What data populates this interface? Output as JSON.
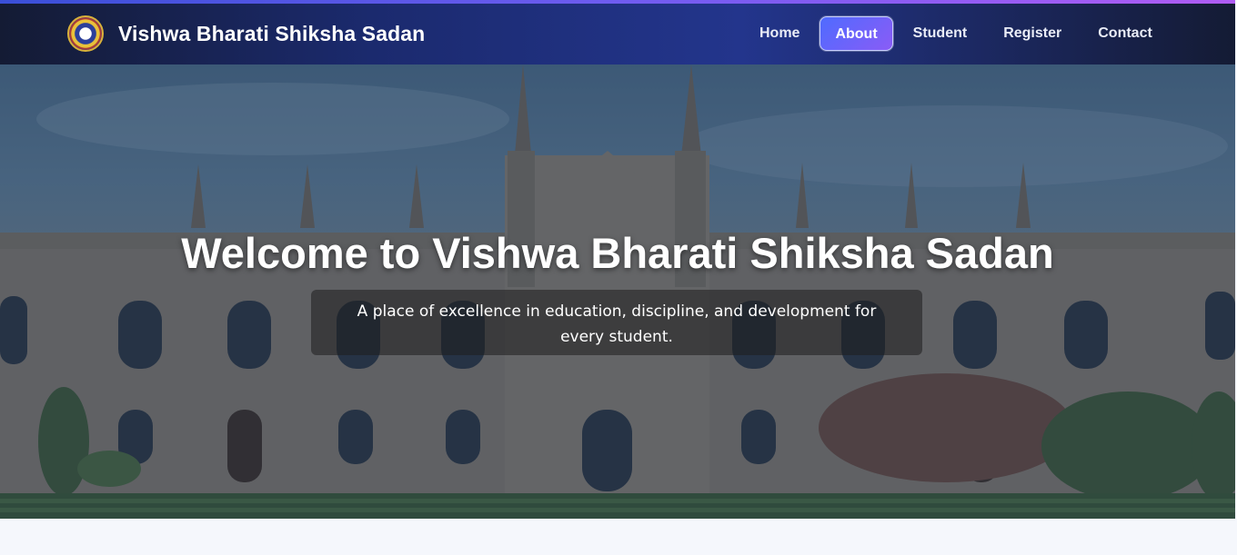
{
  "navbar": {
    "brand": "Vishwa Bharati Shiksha Sadan",
    "items": [
      {
        "label": "Home",
        "active": false
      },
      {
        "label": "About",
        "active": true
      },
      {
        "label": "Student",
        "active": false
      },
      {
        "label": "Register",
        "active": false
      },
      {
        "label": "Contact",
        "active": false
      }
    ]
  },
  "hero": {
    "title": "Welcome to Vishwa Bharati Shiksha Sadan",
    "subtitle": "A place of excellence in education, discipline, and development for every student."
  },
  "colors": {
    "nav_bg": "#1b2a6e",
    "accent_start": "#4f6bff",
    "accent_end": "#8a5cf6"
  }
}
